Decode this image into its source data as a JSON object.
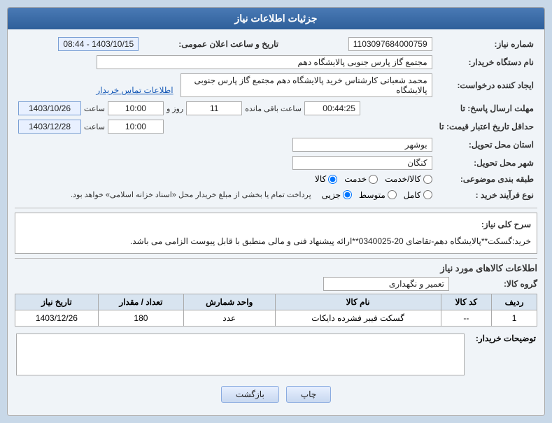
{
  "header": {
    "title": "جزئیات اطلاعات نیاز"
  },
  "fields": {
    "shomare_niaz_label": "شماره نیاز:",
    "shomare_niaz_value": "1103097684000759",
    "nam_dastgah_label": "نام دستگاه خریدار:",
    "nam_dastgah_value": "مجتمع گاز پارس جنوبی  پالایشگاه دهم",
    "ij_konande_label": "ایجاد کننده درخواست:",
    "ij_konande_value": "محمد شعبانی کارشناس خرید پالایشگاه دهم  مجتمع گاز پارس جنوبی  پالایشگاه",
    "ij_konande_link": "اطلاعات تماس خریدار",
    "mohlat_ersal_label": "مهلت ارسال پاسخ: تا",
    "tarikh_ersal": "1403/10/26",
    "saat_ersal": "10:00",
    "roz": "11",
    "baqi_label": "ساعت باقی مانده",
    "baqi_value": "00:44:25",
    "hadag_tarikh_label": "حداقل تاریخ اعتبار قیمت: تا",
    "hadag_tarikh": "1403/12/28",
    "hadag_saat": "10:00",
    "ostan_label": "استان محل تحویل:",
    "ostan_value": "بوشهر",
    "shahr_label": "شهر محل تحویل:",
    "shahr_value": "کنگان",
    "tabaqe_label": "طبقه بندی موضوعی:",
    "tabaqe_options": [
      "کالا",
      "خدمت",
      "کالا/خدمت"
    ],
    "tabaqe_selected": "کالا",
    "navoe_farayand_label": "نوع فرآیند خرید :",
    "navoe_options": [
      "جزیی",
      "متوسط",
      "کامل"
    ],
    "navoe_note": "پرداخت تمام یا بخشی از مبلغ خریدار محل «اسناد خزانه اسلامی» خواهد بود.",
    "sarj_title": "سرح کلی نیاز:",
    "sarj_text": "خرید:گسکت**پالایشگاه دهم-تقاضای 20-0340025**ارائه پیشنهاد فنی و مالی منطبق با قابل پیوست الزامی می باشد.",
    "items_title": "اطلاعات کالاهای مورد نیاز",
    "group_label": "گروه کالا:",
    "group_value": "تعمیر و نگهداری",
    "table": {
      "headers": [
        "ردیف",
        "کد کالا",
        "نام کالا",
        "واحد شمارش",
        "تعداد / مقدار",
        "تاریخ نیاز"
      ],
      "rows": [
        {
          "radif": "1",
          "kod": "--",
          "nam": "گسکت فیبر فشرده دایکات",
          "vahed": "عدد",
          "tedaad": "180",
          "tarikh": "1403/12/26"
        }
      ]
    },
    "tozih_label": "توضیحات خریدار:",
    "tozih_value": "",
    "btn_chap": "چاپ",
    "btn_bazgasht": "بازگشت",
    "tarikh_label": "تاریخ و ساعت اعلان عمومی:",
    "tarikh_value": "1403/10/15 - 08:44"
  }
}
